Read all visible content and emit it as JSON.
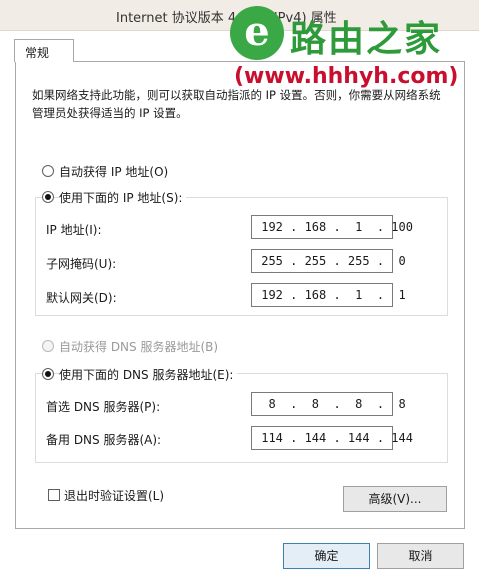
{
  "window": {
    "title": "Internet 协议版本 4 (TCP/IPv4) 属性"
  },
  "tabs": [
    {
      "label": "常规"
    }
  ],
  "description": "如果网络支持此功能，则可以获取自动指派的 IP 设置。否则，你需要从网络系统管理员处获得适当的 IP 设置。",
  "ip_section": {
    "auto_label": "自动获得 IP 地址(O)",
    "manual_label": "使用下面的 IP 地址(S):",
    "fields": [
      {
        "label": "IP 地址(I):",
        "value": " 192 . 168 .  1  . 100"
      },
      {
        "label": "子网掩码(U):",
        "value": " 255 . 255 . 255 .  0"
      },
      {
        "label": "默认网关(D):",
        "value": " 192 . 168 .  1  .  1"
      }
    ]
  },
  "dns_section": {
    "auto_label": "自动获得 DNS 服务器地址(B)",
    "manual_label": "使用下面的 DNS 服务器地址(E):",
    "fields": [
      {
        "label": "首选 DNS 服务器(P):",
        "value": "  8  .  8  .  8  .  8"
      },
      {
        "label": "备用 DNS 服务器(A):",
        "value": " 114 . 144 . 144 . 144"
      }
    ]
  },
  "validate_label": "退出时验证设置(L)",
  "advanced_button": "高级(V)...",
  "ok_button": "确定",
  "cancel_button": "取消",
  "watermark": {
    "logo_text": "路由之家",
    "url": "(www.hhhyh.com)"
  },
  "colors": {
    "watermark_green": "#2e9a3a",
    "watermark_red": "#c8102e",
    "default_button_border": "#3c7fb1"
  }
}
